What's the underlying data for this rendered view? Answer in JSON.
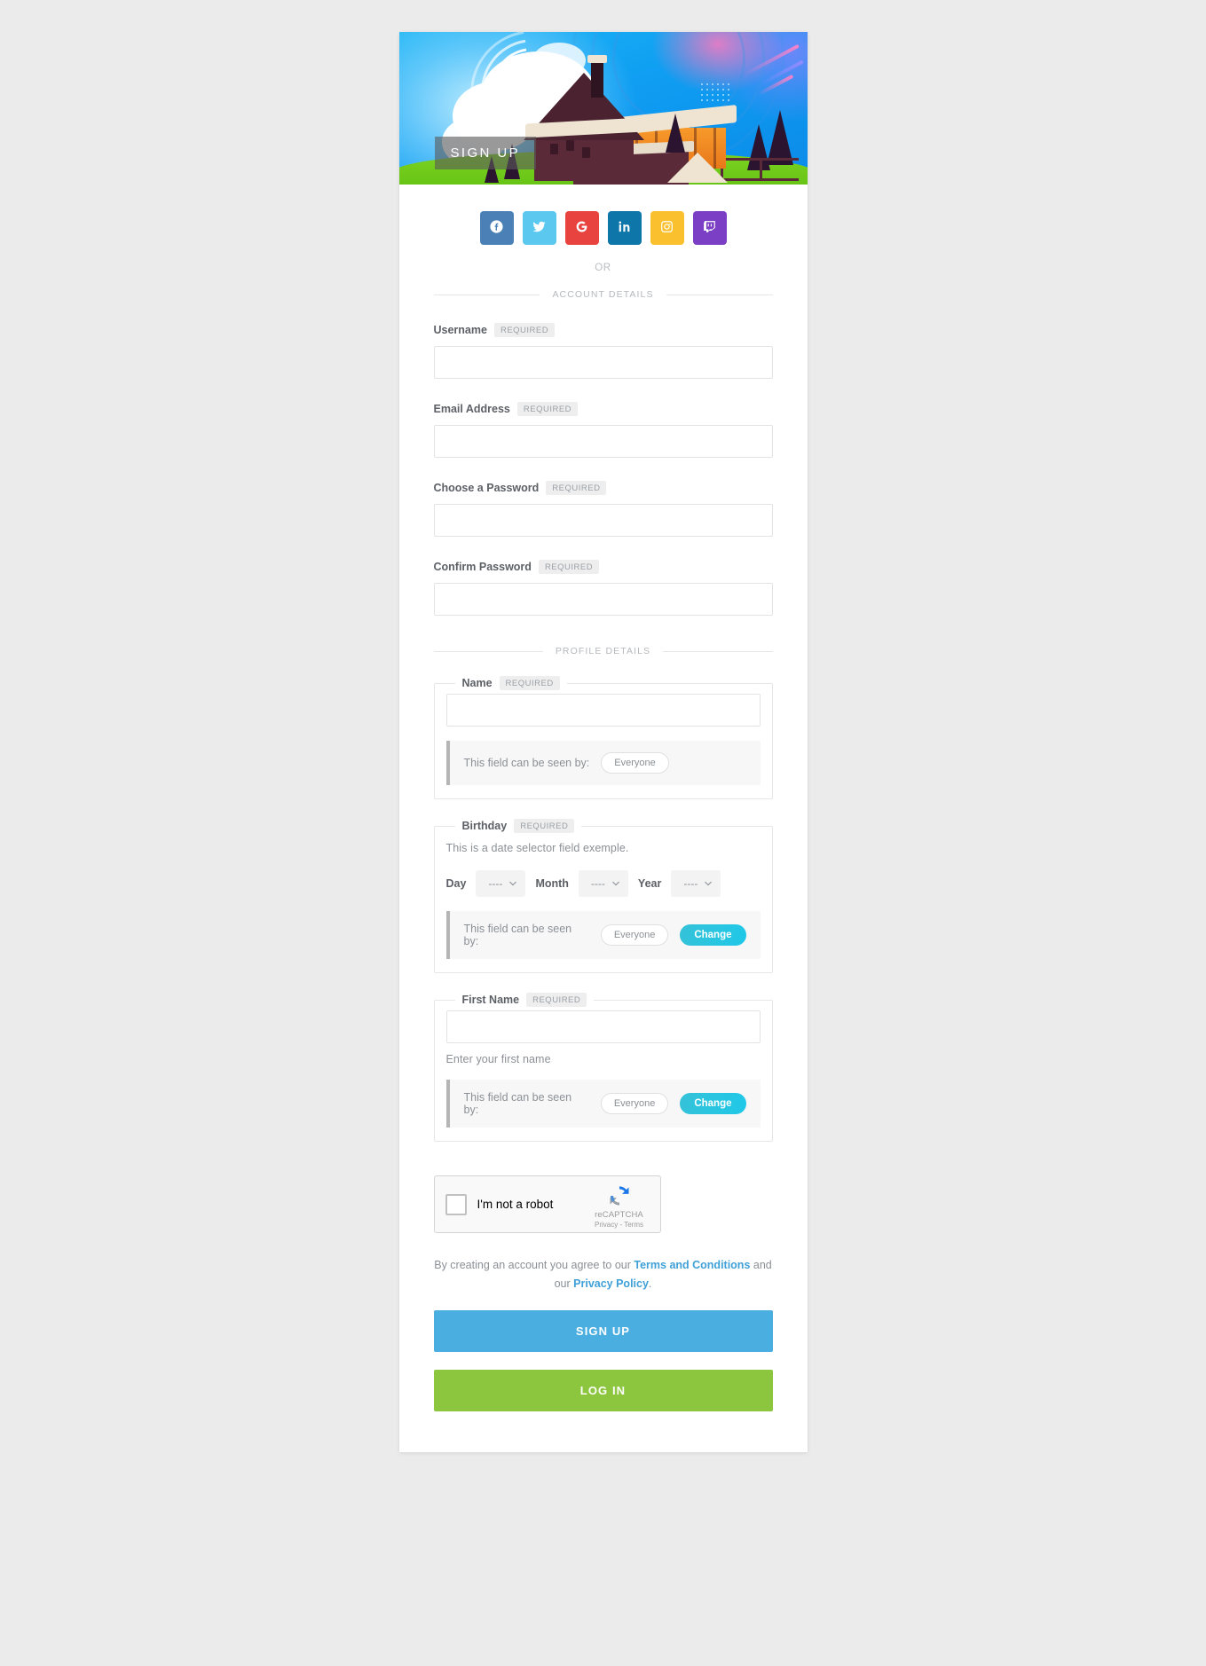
{
  "hero": {
    "label": "SIGN UP",
    "alt": "mountain-cabin-illustration"
  },
  "social": {
    "buttons": [
      {
        "name": "facebook",
        "icon": "facebook-icon",
        "color": "#4a80b5"
      },
      {
        "name": "twitter",
        "icon": "twitter-icon",
        "color": "#5bc8f0"
      },
      {
        "name": "google",
        "icon": "google-icon",
        "color": "#e8433f"
      },
      {
        "name": "linkedin",
        "icon": "linkedin-icon",
        "color": "#0e76a8"
      },
      {
        "name": "instagram",
        "icon": "instagram-icon",
        "color": "#fbc02d"
      },
      {
        "name": "twitch",
        "icon": "twitch-icon",
        "color": "#7a3fc4"
      }
    ]
  },
  "or_label": "OR",
  "sections": {
    "account_details": "ACCOUNT DETAILS",
    "profile_details": "PROFILE DETAILS"
  },
  "required_badge": "REQUIRED",
  "account_fields": [
    {
      "label": "Username",
      "value": "",
      "placeholder": ""
    },
    {
      "label": "Email Address",
      "value": "",
      "placeholder": ""
    },
    {
      "label": "Choose a Password",
      "value": "",
      "placeholder": ""
    },
    {
      "label": "Confirm Password",
      "value": "",
      "placeholder": ""
    }
  ],
  "profile": {
    "name_field": {
      "label": "Name",
      "value": "",
      "visibility_text": "This field can be seen by:",
      "visibility_value": "Everyone"
    },
    "birthday_field": {
      "label": "Birthday",
      "description": "This is a date selector field exemple.",
      "day_label": "Day",
      "month_label": "Month",
      "year_label": "Year",
      "day_value": "----",
      "month_value": "----",
      "year_value": "----",
      "visibility_text": "This field can be seen by:",
      "visibility_value": "Everyone",
      "change_label": "Change"
    },
    "first_name_field": {
      "label": "First Name",
      "value": "",
      "helper": "Enter your first name",
      "visibility_text": "This field can be seen by:",
      "visibility_value": "Everyone",
      "change_label": "Change"
    }
  },
  "captcha": {
    "checkbox_label": "I'm not a robot",
    "brand": "reCAPTCHA",
    "links": "Privacy - Terms"
  },
  "terms": {
    "prefix": "By creating an account you agree to our ",
    "link1": "Terms and Conditions",
    "middle": " and our ",
    "link2": "Privacy Policy",
    "suffix": "."
  },
  "actions": {
    "signup_label": "SIGN UP",
    "login_label": "LOG IN"
  },
  "colors": {
    "signup": "#4aaee0",
    "login": "#8cc63f",
    "change": "#1fc8e8",
    "link": "#3fa0d8"
  }
}
